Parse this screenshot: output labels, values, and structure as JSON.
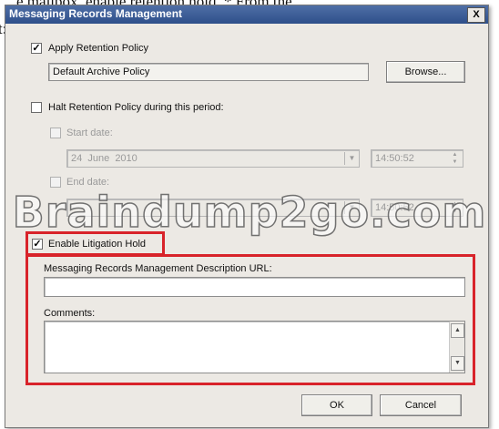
{
  "background": {
    "line1": "e mailbox, enable retention hold. * From the",
    "line2": "t:"
  },
  "window": {
    "title": "Messaging Records Management",
    "close_label": "X"
  },
  "retention": {
    "apply_label": "Apply Retention Policy",
    "apply_checked": true,
    "policy_value": "Default Archive Policy",
    "browse_label": "Browse..."
  },
  "halt": {
    "label": "Halt Retention Policy during this period:",
    "checked": false,
    "start_label": "Start date:",
    "start_date": "24  June  2010",
    "start_time": "14:50:52",
    "end_label": "End date:",
    "end_time": "14:50:52"
  },
  "litigation": {
    "label": "Enable Litigation Hold",
    "checked": true,
    "url_label": "Messaging Records Management Description URL:",
    "url_value": "",
    "comments_label": "Comments:",
    "comments_value": ""
  },
  "footer": {
    "ok_label": "OK",
    "cancel_label": "Cancel"
  },
  "watermark": "Braindump2go.com",
  "colors": {
    "highlight": "#d8232a",
    "titlebar": "#2e4f8a"
  },
  "icons": {
    "dropdown": "chevron-down-icon",
    "checkmark": "checkmark-icon"
  }
}
